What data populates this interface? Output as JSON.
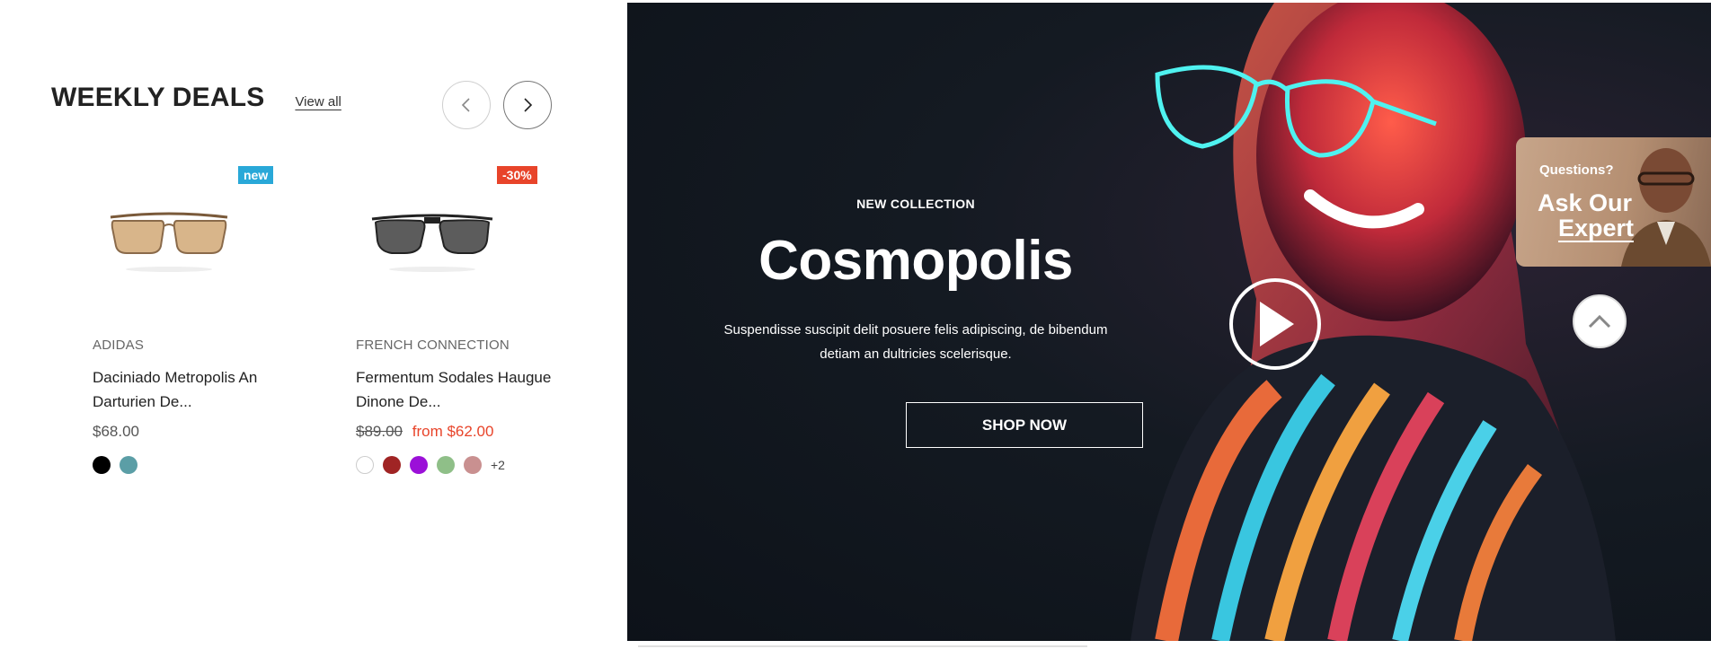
{
  "deals": {
    "title": "WEEKLY DEALS",
    "view_all": "View all",
    "prev_icon": "chevron-left-icon",
    "next_icon": "chevron-right-icon",
    "products": [
      {
        "badge": "new",
        "brand": "ADIDAS",
        "name": "Daciniado Metropolis An Darturien De...",
        "price": "$68.00",
        "swatches": [
          "#000000",
          "#5b9ea6"
        ],
        "more": ""
      },
      {
        "badge": "-30%",
        "brand": "FRENCH CONNECTION",
        "name": "Fermentum Sodales Haugue Dinone De...",
        "price_old": "$89.00",
        "price_new": "from $62.00",
        "swatches": [
          "#ffffff",
          "#a02424",
          "#9b10d8",
          "#8fbf88",
          "#c99090"
        ],
        "more": "+2"
      }
    ]
  },
  "hero": {
    "eyebrow": "NEW COLLECTION",
    "headline": "Cosmopolis",
    "description": "Suspendisse suscipit delit posuere felis adipiscing, de bibendum detiam an dultricies scelerisque.",
    "cta": "SHOP NOW",
    "play_icon": "play-icon"
  },
  "expert_widget": {
    "question": "Questions?",
    "line1": "Ask Our",
    "line2": "Expert"
  },
  "scroll_top_icon": "chevron-up-icon",
  "colors": {
    "badge_new": "#29a8d8",
    "badge_sale": "#e8442a",
    "sale_price": "#e8442a"
  }
}
